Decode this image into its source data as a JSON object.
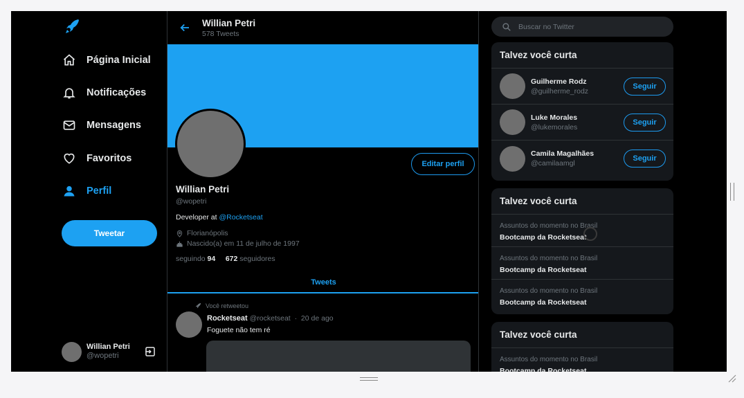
{
  "nav": {
    "items": [
      {
        "label": "Página Inicial",
        "icon": "home-icon"
      },
      {
        "label": "Notificações",
        "icon": "bell-icon"
      },
      {
        "label": "Mensagens",
        "icon": "mail-icon"
      },
      {
        "label": "Favoritos",
        "icon": "heart-icon"
      },
      {
        "label": "Perfil",
        "icon": "person-icon"
      }
    ],
    "tweet_button": "Tweetar",
    "me": {
      "name": "Willian Petri",
      "handle": "@wopetri"
    }
  },
  "header": {
    "name": "Willian Petri",
    "tweet_count": "578 Tweets"
  },
  "profile": {
    "edit_button": "Editar perfil",
    "name": "Willian Petri",
    "handle": "@wopetri",
    "bio_prefix": "Developer at ",
    "bio_link": "@Rocketseat",
    "location": "Florianópolis",
    "birthday": "Nascido(a) em 11 de julho de 1997",
    "following_label": "seguindo",
    "following_count": "94",
    "followers_count": "672",
    "followers_label": "seguidores",
    "tab": "Tweets"
  },
  "tweet": {
    "retweet_label": "Você retweetou",
    "author": "Rocketseat",
    "handle": "@rocketseat",
    "separator": "·",
    "date": "20 de ago",
    "text": "Foguete não tem ré"
  },
  "sidebar": {
    "search_placeholder": "Buscar no Twitter",
    "follow_card": {
      "title": "Talvez você curta",
      "users": [
        {
          "name": "Guilherme Rodz",
          "handle": "@guilherme_rodz",
          "button": "Seguir"
        },
        {
          "name": "Luke Morales",
          "handle": "@lukemorales",
          "button": "Seguir"
        },
        {
          "name": "Camila Magalhães",
          "handle": "@camilaamgl",
          "button": "Seguir"
        }
      ]
    },
    "trend_card": {
      "title": "Talvez você curta",
      "trends": [
        {
          "context": "Assuntos do momento no Brasil",
          "topic": "Bootcamp da Rocketseat"
        },
        {
          "context": "Assuntos do momento no Brasil",
          "topic": "Bootcamp da Rocketseat"
        },
        {
          "context": "Assuntos do momento no Brasil",
          "topic": "Bootcamp da Rocketseat"
        }
      ]
    },
    "trend_card_2": {
      "title": "Talvez você curta",
      "trends": [
        {
          "context": "Assuntos do momento no Brasil",
          "topic": "Bootcamp da Rocketseat"
        }
      ]
    }
  },
  "colors": {
    "accent": "#1da1f2",
    "background": "#000000",
    "card": "#15181c"
  }
}
